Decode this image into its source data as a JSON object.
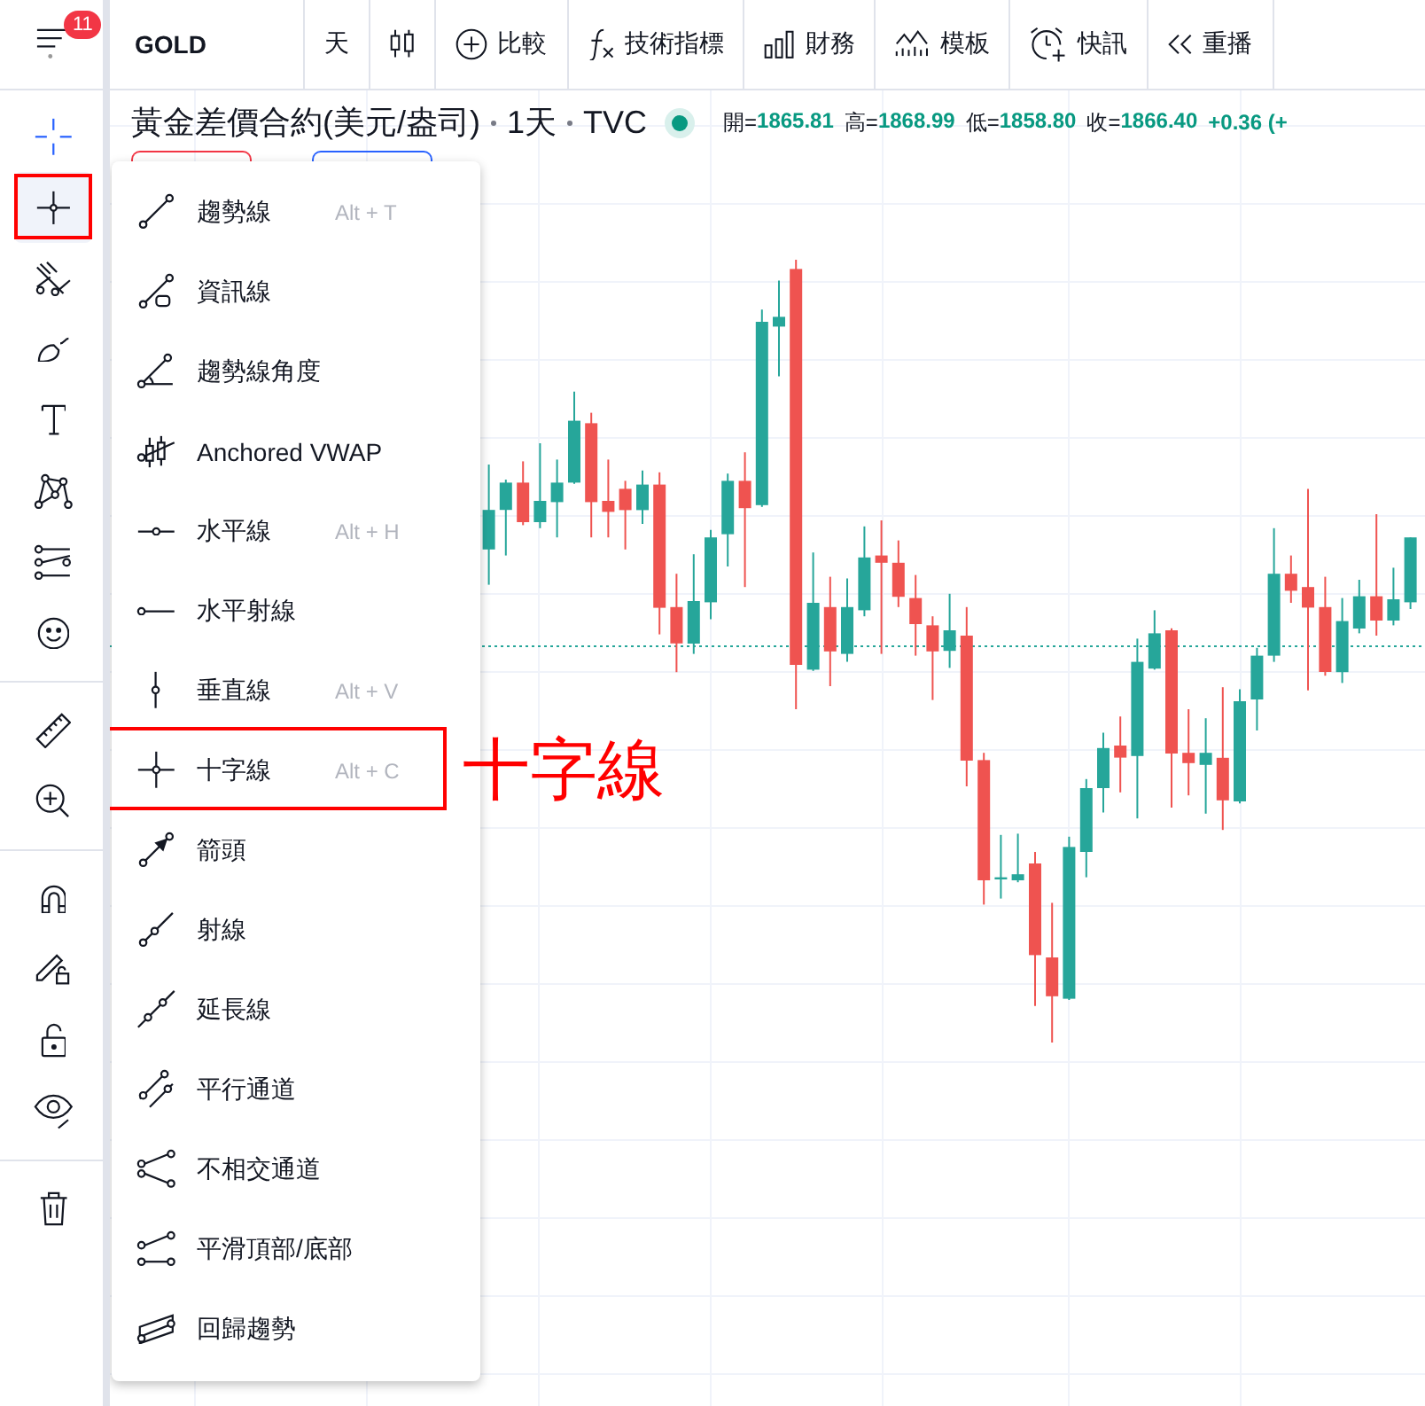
{
  "top_toolbar": {
    "menu_badge": "11",
    "symbol": "GOLD",
    "items": [
      {
        "kind": "interval",
        "label": "天"
      },
      {
        "kind": "chart-type"
      },
      {
        "kind": "compare",
        "label": "比較"
      },
      {
        "kind": "indicators",
        "label": "技術指標"
      },
      {
        "kind": "financials",
        "label": "財務"
      },
      {
        "kind": "templates",
        "label": "模板"
      },
      {
        "kind": "alert",
        "label": "快訊"
      },
      {
        "kind": "replay",
        "label": "重播"
      }
    ]
  },
  "legend": {
    "title": "黃金差價合約(美元/盎司)",
    "interval": "1天",
    "source": "TVC",
    "ohlc": [
      {
        "label": "開=",
        "value": "1865.81"
      },
      {
        "label": "高=",
        "value": "1868.99"
      },
      {
        "label": "低=",
        "value": "1858.80"
      },
      {
        "label": "收=",
        "value": "1866.40"
      }
    ],
    "change": "+0.36 (+"
  },
  "left_toolbar": {
    "groups": [
      {
        "tools": [
          {
            "kind": "cursor",
            "selected": false,
            "highlighted": false
          },
          {
            "kind": "crosshair",
            "selected": true,
            "highlighted": true
          },
          {
            "kind": "pitchfork",
            "selected": false,
            "highlighted": false
          },
          {
            "kind": "brush",
            "selected": false,
            "highlighted": false
          },
          {
            "kind": "text",
            "selected": false,
            "highlighted": false
          },
          {
            "kind": "pattern",
            "selected": false,
            "highlighted": false
          },
          {
            "kind": "projection",
            "selected": false,
            "highlighted": false
          },
          {
            "kind": "emoji",
            "selected": false,
            "highlighted": false
          }
        ]
      },
      {
        "tools": [
          {
            "kind": "ruler",
            "selected": false,
            "highlighted": false
          },
          {
            "kind": "zoom",
            "selected": false,
            "highlighted": false
          }
        ]
      },
      {
        "tools": [
          {
            "kind": "magnet",
            "selected": false,
            "highlighted": false
          },
          {
            "kind": "lock-drawing",
            "selected": false,
            "highlighted": false
          },
          {
            "kind": "lock",
            "selected": false,
            "highlighted": false
          },
          {
            "kind": "eye",
            "selected": false,
            "highlighted": false
          }
        ]
      },
      {
        "tools": [
          {
            "kind": "trash",
            "selected": false,
            "highlighted": false
          }
        ]
      }
    ]
  },
  "tool_menu": {
    "items": [
      {
        "kind": "trend-line",
        "label": "趨勢線",
        "shortcut": "Alt + T",
        "highlighted": false
      },
      {
        "kind": "info-line",
        "label": "資訊線",
        "highlighted": false
      },
      {
        "kind": "trend-angle",
        "label": "趨勢線角度",
        "highlighted": false
      },
      {
        "kind": "vwap",
        "label": "Anchored VWAP",
        "highlighted": false
      },
      {
        "kind": "horizontal-line",
        "label": "水平線",
        "shortcut": "Alt + H",
        "highlighted": false
      },
      {
        "kind": "horizontal-ray",
        "label": "水平射線",
        "highlighted": false
      },
      {
        "kind": "vertical-line",
        "label": "垂直線",
        "shortcut": "Alt + V",
        "highlighted": false
      },
      {
        "kind": "cross-line",
        "label": "十字線",
        "shortcut": "Alt + C",
        "highlighted": true
      },
      {
        "kind": "arrow",
        "label": "箭頭",
        "highlighted": false
      },
      {
        "kind": "ray",
        "label": "射線",
        "highlighted": false
      },
      {
        "kind": "extended-line",
        "label": "延長線",
        "highlighted": false
      },
      {
        "kind": "parallel-channel",
        "label": "平行通道",
        "highlighted": false
      },
      {
        "kind": "disjoint-channel",
        "label": "不相交通道",
        "highlighted": false
      },
      {
        "kind": "flat-top-bottom",
        "label": "平滑頂部/底部",
        "highlighted": false
      },
      {
        "kind": "regression-trend",
        "label": "回歸趨勢",
        "highlighted": false
      }
    ]
  },
  "callout": {
    "label": "十字線"
  }
}
